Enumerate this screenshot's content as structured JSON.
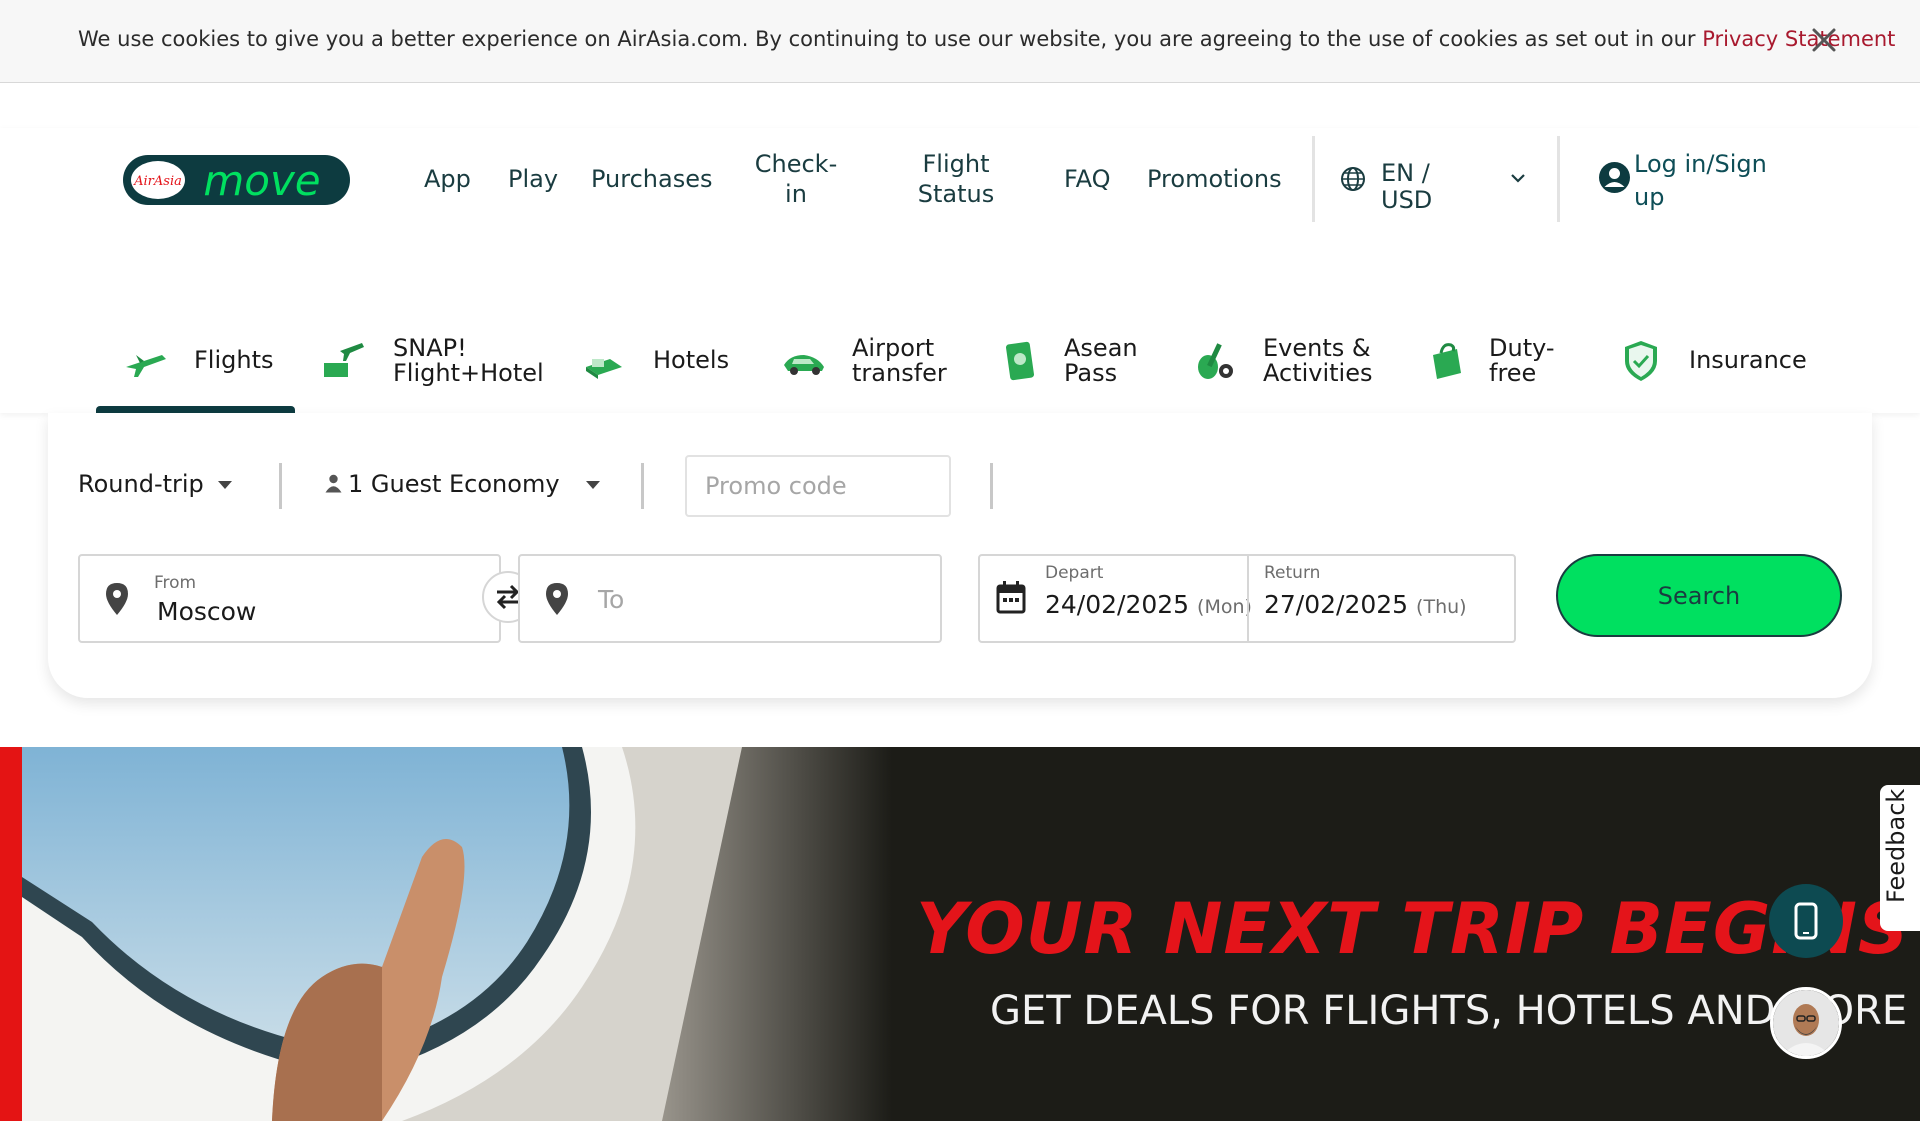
{
  "cookie_banner": {
    "text": "We use cookies to give you a better experience on AirAsia.com. By continuing to use our website, you are agreeing to the use of cookies as set out in our ",
    "link": "Privacy Statement"
  },
  "header": {
    "logo_icon": "airasia-move-logo",
    "nav": [
      "App",
      "Play",
      "Purchases",
      "Check-in",
      "Flight Status",
      "FAQ",
      "Promotions"
    ],
    "language": "EN / USD",
    "login": "Log in/Sign up"
  },
  "tabs": [
    {
      "label": "Flights",
      "icon": "plane-icon"
    },
    {
      "label": "SNAP! Flight+Hotel",
      "icon": "plane-hotel-icon"
    },
    {
      "label": "Hotels",
      "icon": "bed-icon"
    },
    {
      "label": "Airport transfer",
      "icon": "car-icon"
    },
    {
      "label": "Asean Pass",
      "icon": "pass-icon"
    },
    {
      "label": "Events & Activities",
      "icon": "guitar-icon"
    },
    {
      "label": "Duty-free",
      "icon": "bag-icon"
    },
    {
      "label": "Insurance",
      "icon": "shield-icon"
    }
  ],
  "search": {
    "trip_type": "Round-trip",
    "guests": "1 Guest Economy",
    "promo_placeholder": "Promo code",
    "from_label": "From",
    "from_value": "Moscow",
    "to_placeholder": "To",
    "depart_label": "Depart",
    "depart_date": "24/02/2025",
    "depart_day": "(Mon)",
    "return_label": "Return",
    "return_date": "27/02/2025",
    "return_day": "(Thu)",
    "search_button": "Search"
  },
  "banner": {
    "headline": "YOUR NEXT TRIP BEGINS HERE",
    "subline": "GET DEALS FOR FLIGHTS, HOTELS AND MORE"
  },
  "feedback": "Feedback",
  "colors": {
    "brand_green": "#00e060",
    "brand_dark": "#0d3b40",
    "headline_red": "#e4141a",
    "link_red": "#a8192e"
  }
}
